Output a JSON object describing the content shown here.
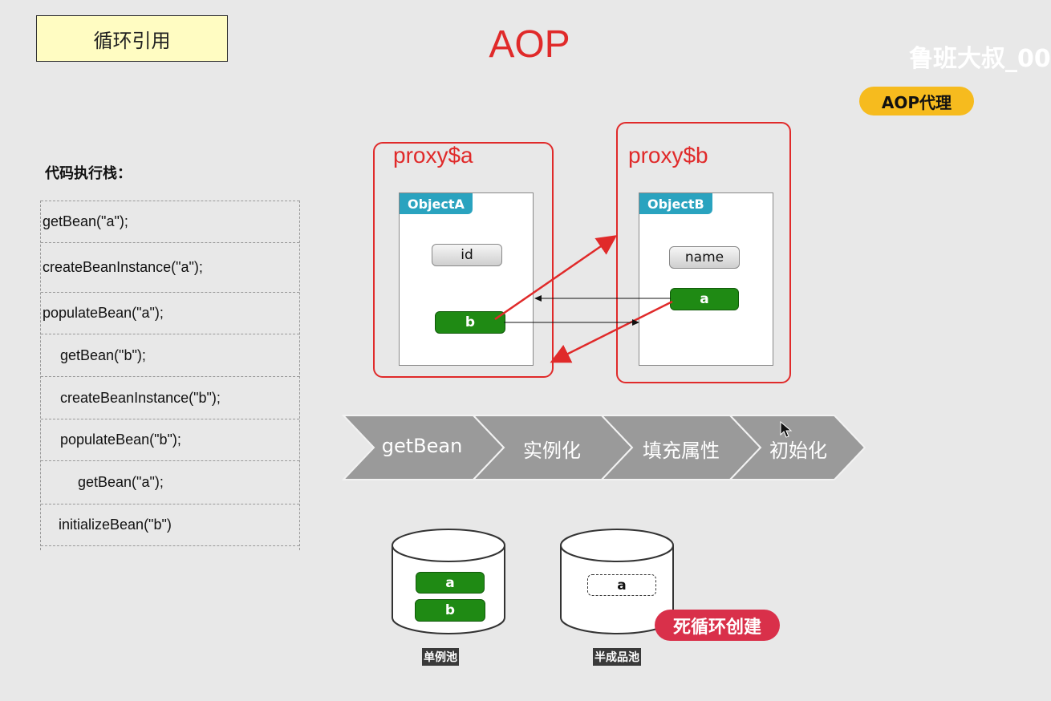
{
  "header": {
    "topic": "循环引用",
    "title": "AOP",
    "watermark": "鲁班大叔_00",
    "badge": "AOP代理"
  },
  "stack": {
    "title": "代码执行栈：",
    "rows": [
      "getBean(\"a\");",
      "createBeanInstance(\"a\");",
      "populateBean(\"a\");",
      "getBean(\"b\");",
      "createBeanInstance(\"b\");",
      "populateBean(\"b\");",
      "getBean(\"a\");",
      "initializeBean(\"b\")"
    ]
  },
  "proxies": {
    "a": {
      "label": "proxy$a",
      "object": "ObjectA",
      "field1": "id",
      "field2": "b"
    },
    "b": {
      "label": "proxy$b",
      "object": "ObjectB",
      "field1": "name",
      "field2": "a"
    }
  },
  "pipeline": {
    "steps": [
      "getBean",
      "实例化",
      "填充属性",
      "初始化"
    ],
    "color": "#9a9a9a"
  },
  "pools": {
    "singleton": {
      "label": "单例池",
      "items": [
        "a",
        "b"
      ]
    },
    "early": {
      "label": "半成品池",
      "items": [
        "a"
      ]
    }
  },
  "alert": "死循环创建",
  "colors": {
    "accent_red": "#e02a2a",
    "green": "#1f8a14",
    "teal": "#2aa3bf",
    "yellow": "#f6bb1e",
    "alert_red": "#d9304a"
  }
}
